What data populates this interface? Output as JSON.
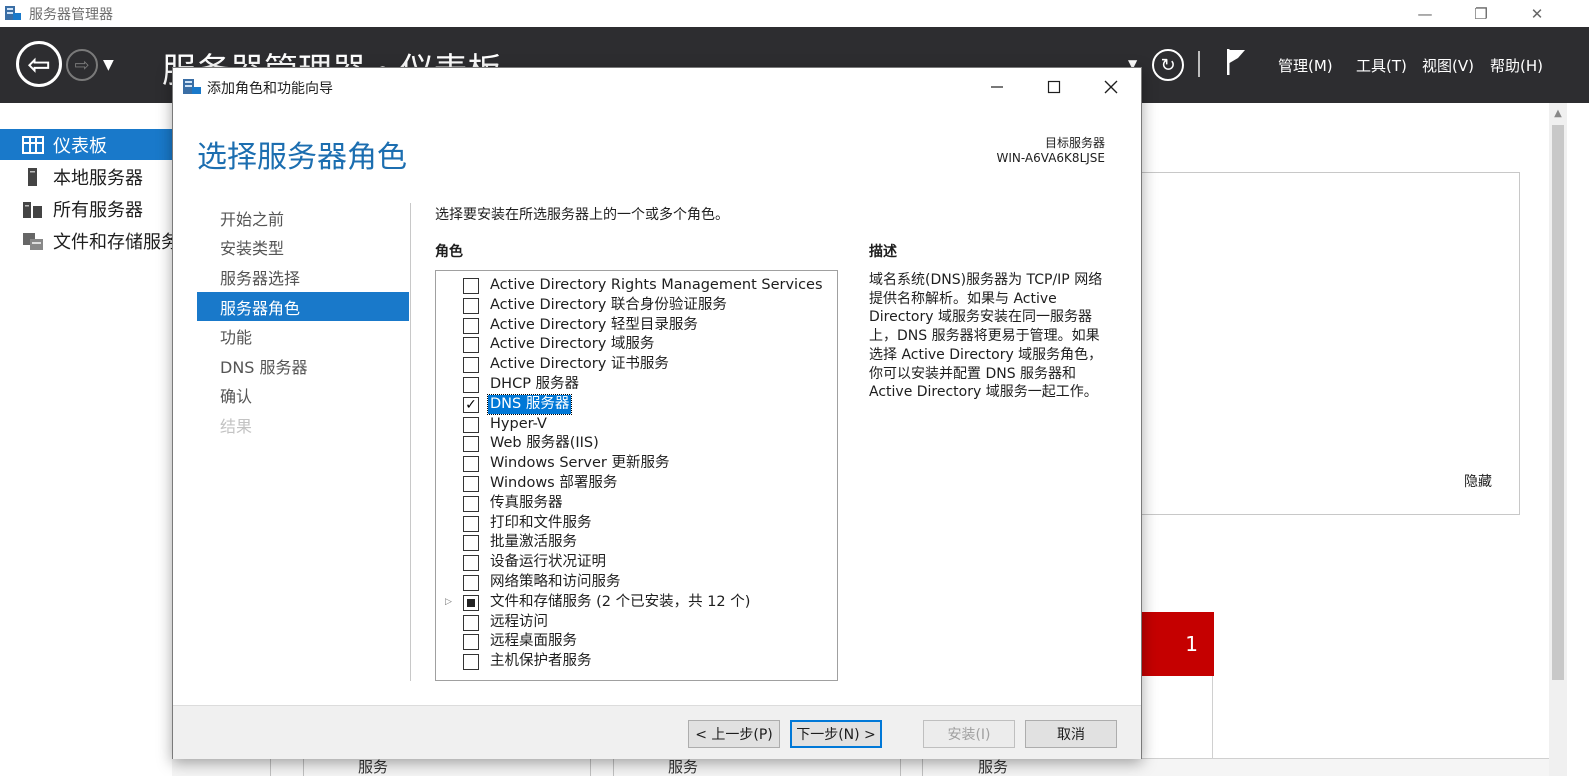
{
  "app": {
    "title": "服务器管理器"
  },
  "header": {
    "title": "服务器管理器 • 仪表板",
    "menus": [
      "管理(M)",
      "工具(T)",
      "视图(V)",
      "帮助(H)"
    ]
  },
  "sidebar": {
    "items": [
      {
        "label": "仪表板",
        "icon": "dashboard-icon",
        "active": true
      },
      {
        "label": "本地服务器",
        "icon": "server-icon",
        "active": false
      },
      {
        "label": "所有服务器",
        "icon": "servers-icon",
        "active": false
      },
      {
        "label": "文件和存储服务",
        "icon": "storage-icon",
        "active": false
      }
    ]
  },
  "right": {
    "hide_link": "隐藏",
    "badge_count": "1"
  },
  "bottom": {
    "labels": [
      "服务",
      "服务",
      "服务"
    ]
  },
  "wizard": {
    "title": "添加角色和功能向导",
    "heading": "选择服务器角色",
    "target_label": "目标服务器",
    "target_value": "WIN-A6VA6K8LJSE",
    "steps": [
      {
        "label": "开始之前",
        "state": "normal"
      },
      {
        "label": "安装类型",
        "state": "normal"
      },
      {
        "label": "服务器选择",
        "state": "normal"
      },
      {
        "label": "服务器角色",
        "state": "active"
      },
      {
        "label": "功能",
        "state": "normal"
      },
      {
        "label": "DNS 服务器",
        "state": "normal"
      },
      {
        "label": "确认",
        "state": "normal"
      },
      {
        "label": "结果",
        "state": "disabled"
      }
    ],
    "instruction": "选择要安装在所选服务器上的一个或多个角色。",
    "roles_label": "角色",
    "description_label": "描述",
    "description": "域名系统(DNS)服务器为 TCP/IP 网络提供名称解析。如果与 Active Directory 域服务安装在同一服务器上，DNS 服务器将更易于管理。如果选择 Active Directory 域服务角色，你可以安装并配置 DNS 服务器和 Active Directory 域服务一起工作。",
    "roles": [
      {
        "label": "Active Directory Rights Management Services",
        "state": "unchecked"
      },
      {
        "label": "Active Directory 联合身份验证服务",
        "state": "unchecked"
      },
      {
        "label": "Active Directory 轻型目录服务",
        "state": "unchecked"
      },
      {
        "label": "Active Directory 域服务",
        "state": "unchecked"
      },
      {
        "label": "Active Directory 证书服务",
        "state": "unchecked"
      },
      {
        "label": "DHCP 服务器",
        "state": "unchecked"
      },
      {
        "label": "DNS 服务器",
        "state": "checked",
        "selected": true
      },
      {
        "label": "Hyper-V",
        "state": "unchecked"
      },
      {
        "label": "Web 服务器(IIS)",
        "state": "unchecked"
      },
      {
        "label": "Windows Server 更新服务",
        "state": "unchecked"
      },
      {
        "label": "Windows 部署服务",
        "state": "unchecked"
      },
      {
        "label": "传真服务器",
        "state": "unchecked"
      },
      {
        "label": "打印和文件服务",
        "state": "unchecked"
      },
      {
        "label": "批量激活服务",
        "state": "unchecked"
      },
      {
        "label": "设备运行状况证明",
        "state": "unchecked"
      },
      {
        "label": "网络策略和访问服务",
        "state": "unchecked"
      },
      {
        "label": "文件和存储服务 (2 个已安装，共 12 个)",
        "state": "partial",
        "expandable": true
      },
      {
        "label": "远程访问",
        "state": "unchecked"
      },
      {
        "label": "远程桌面服务",
        "state": "unchecked"
      },
      {
        "label": "主机保护者服务",
        "state": "unchecked"
      }
    ],
    "buttons": {
      "prev": "< 上一步(P)",
      "next": "下一步(N) >",
      "install": "安装(I)",
      "cancel": "取消"
    }
  }
}
